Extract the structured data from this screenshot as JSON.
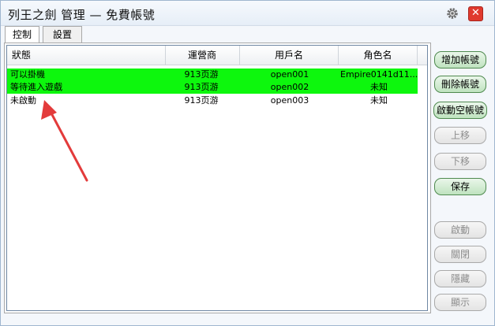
{
  "window": {
    "title": "列王之劍 管理 — 免費帳號"
  },
  "tabs": [
    {
      "label": "控制",
      "active": true
    },
    {
      "label": "設置",
      "active": false
    }
  ],
  "table": {
    "columns": [
      "狀態",
      "運營商",
      "用戶名",
      "角色名"
    ],
    "rows": [
      {
        "status": "可以掛機",
        "operator": "913页游",
        "username": "open001",
        "role": "Empire0141d11...",
        "highlight": true
      },
      {
        "status": "等待進入遊戲",
        "operator": "913页游",
        "username": "open002",
        "role": "未知",
        "highlight": true
      },
      {
        "status": "未啟動",
        "operator": "913页游",
        "username": "open003",
        "role": "未知",
        "highlight": false
      }
    ]
  },
  "buttons": {
    "add_account": "增加帳號",
    "delete_account": "刪除帳號",
    "start_empty_account": "啟動空帳號",
    "move_up": "上移",
    "move_down": "下移",
    "save": "保存",
    "start": "啟動",
    "close": "關閉",
    "hide": "隱藏",
    "show": "顯示"
  },
  "colors": {
    "highlight_row": "#0df70d",
    "annotation_arrow": "#e33b3b",
    "close_button": "#e03a2e"
  },
  "icons": {
    "settings": "gear-icon",
    "close": "close-icon"
  }
}
